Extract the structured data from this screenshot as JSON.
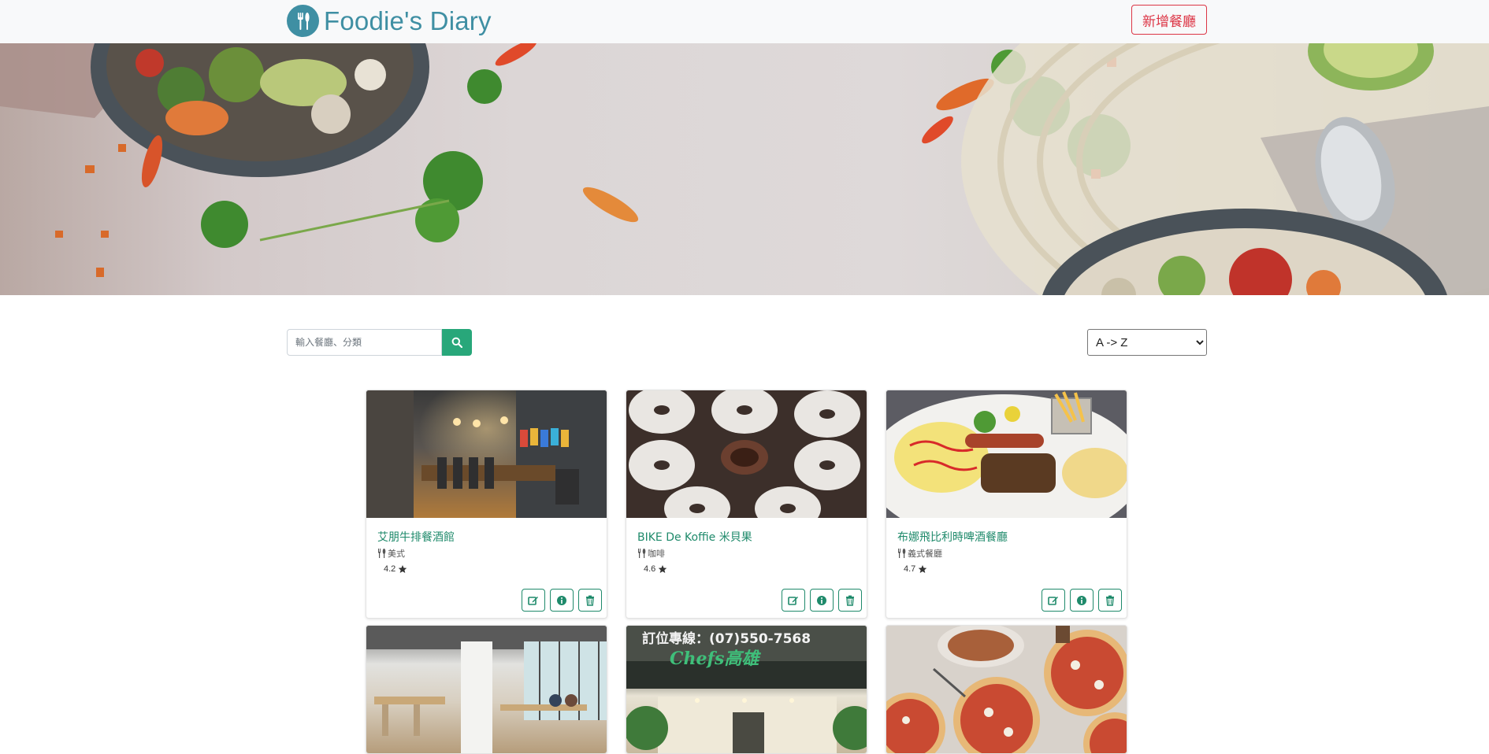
{
  "navbar": {
    "brand_name": "Foodie's Diary",
    "brand_icon": "utensils-icon",
    "add_button_label": "新增餐廳",
    "accent_color": "#3f8fa3",
    "add_button_color": "#dc3545"
  },
  "banner": {
    "image": "food-banner"
  },
  "search": {
    "placeholder": "輸入餐廳、分類",
    "value": "",
    "button_icon": "search-icon",
    "button_color": "#28a77a"
  },
  "sort": {
    "selected": "A -> Z"
  },
  "restaurants": [
    {
      "name": "艾朋牛排餐酒館",
      "category": "美式",
      "rating": "4.2",
      "image": "steakhouse-interior"
    },
    {
      "name": "BIKE De Koffie 米貝果",
      "category": "咖啡",
      "rating": "4.6",
      "image": "bagels"
    },
    {
      "name": "布娜飛比利時啤酒餐廳",
      "category": "義式餐廳",
      "rating": "4.7",
      "image": "breakfast-plate"
    },
    {
      "name": "",
      "category": "",
      "rating": "",
      "image": "cafe-interior"
    },
    {
      "name": "",
      "category": "",
      "rating": "",
      "image": "chefs-storefront",
      "image_text": "訂位專線：(07)550-7568",
      "image_text_2": "Chefs高雄"
    },
    {
      "name": "",
      "category": "",
      "rating": "",
      "image": "pizzas"
    }
  ],
  "card_actions": [
    "edit-icon",
    "info-icon",
    "trash-icon"
  ],
  "card_accent": "#1f8a6b"
}
